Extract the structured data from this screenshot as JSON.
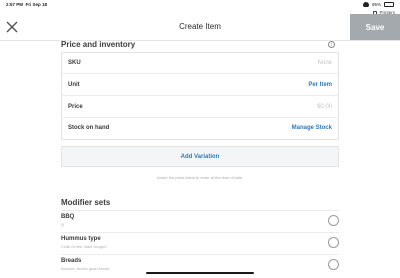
{
  "status_bar": {
    "time": "2:57 PM",
    "date": "Fri Sep 18",
    "battery": "95%",
    "printers_label": "Printers"
  },
  "header": {
    "title": "Create Item",
    "save_label": "Save",
    "close_icon": "close-icon"
  },
  "price_inventory": {
    "title": "Price and inventory",
    "rows": [
      {
        "label": "SKU",
        "value": "None"
      },
      {
        "label": "Unit",
        "value": "Per Item"
      },
      {
        "label": "Price",
        "value": "$0.00"
      },
      {
        "label": "Stock on hand",
        "value": "Manage Stock"
      }
    ],
    "add_variation": "Add Variation",
    "helper_text": "Leave the price blank to enter at the time of sale."
  },
  "modifier_sets": {
    "title": "Modifier sets",
    "items": [
      {
        "name": "BBQ",
        "detail": "Q"
      },
      {
        "name": "Hummus type",
        "detail": "Chali Gmbh, Bahi Dragon"
      },
      {
        "name": "Breads",
        "detail": "Brioche, brown grain bread"
      }
    ]
  },
  "colors": {
    "accent": "#2f7ab9",
    "save_disabled": "#a4a9ad"
  }
}
